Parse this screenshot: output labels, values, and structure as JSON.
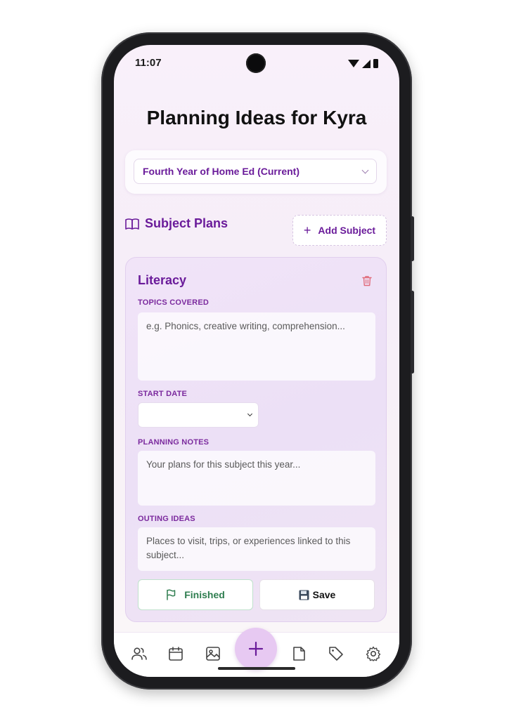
{
  "status_bar": {
    "time": "11:07"
  },
  "header": {
    "title": "Planning Ideas for Kyra"
  },
  "year_selector": {
    "selected": "Fourth Year of Home Ed (Current)"
  },
  "subjects_section": {
    "title": "Subject Plans",
    "add_button_label": "Add Subject"
  },
  "subject_card": {
    "name": "Literacy",
    "topics_label": "TOPICS COVERED",
    "topics_placeholder": "e.g. Phonics, creative writing, comprehension...",
    "start_date_label": "START DATE",
    "start_date_value": "",
    "notes_label": "PLANNING NOTES",
    "notes_placeholder": "Your plans for this subject this year...",
    "outing_label": "OUTING IDEAS",
    "outing_placeholder": "Places to visit, trips, or experiences linked to this subject...",
    "finished_label": "Finished",
    "save_label": "Save"
  },
  "bottom_nav": {
    "items": [
      "people-icon",
      "calendar-icon",
      "image-icon",
      "add-icon",
      "note-icon",
      "tag-icon",
      "settings-icon"
    ]
  },
  "colors": {
    "accent": "#6a1b9a",
    "finished_green": "#2e7d4f",
    "danger": "#e06a7a",
    "fab": "#e7c9f2"
  }
}
